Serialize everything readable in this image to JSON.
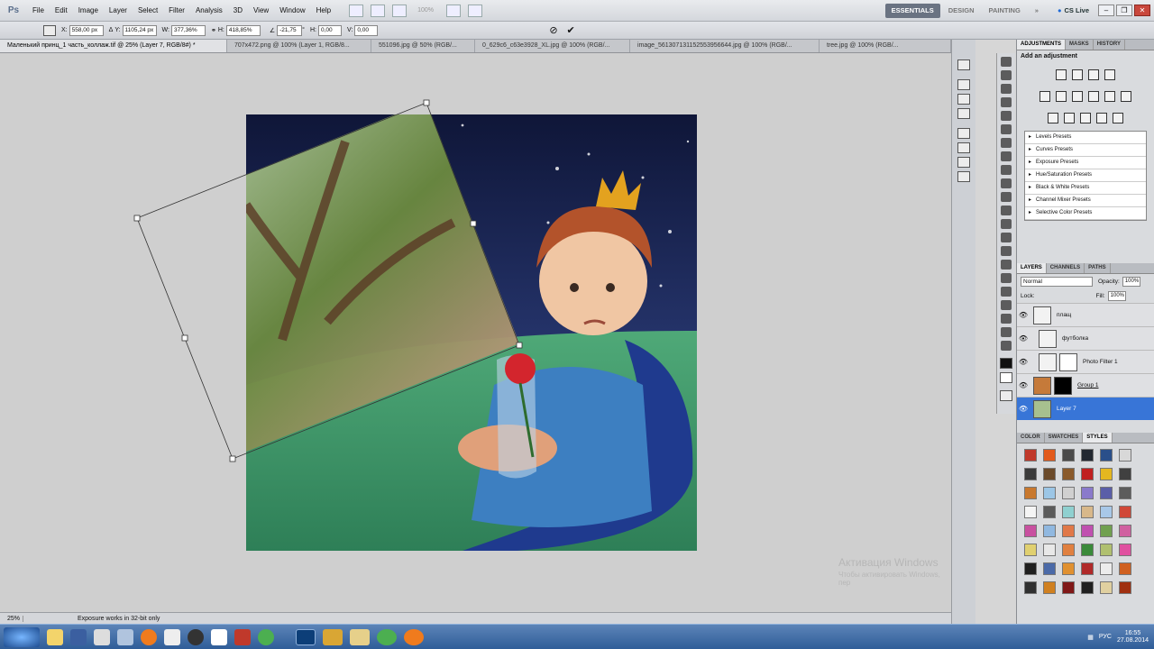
{
  "app": {
    "logo": "Ps",
    "menu": [
      "File",
      "Edit",
      "Image",
      "Layer",
      "Select",
      "Filter",
      "Analysis",
      "3D",
      "View",
      "Window",
      "Help"
    ],
    "zoom_dropdown": "100%",
    "workspaces": [
      "ESSENTIALS",
      "DESIGN",
      "PAINTING"
    ],
    "active_workspace": "ESSENTIALS",
    "more": "»",
    "cs_live": "CS Live"
  },
  "options": {
    "x_label": "X:",
    "x_value": "558,00 px",
    "y_label": "Y:",
    "y_value": "1105,24 px",
    "w_label": "W:",
    "w_value": "377,36%",
    "h_label": "H:",
    "h_value": "418,85%",
    "angle_value": "-21,75",
    "angle_unit": "°",
    "hskew_label": "H:",
    "hskew_value": "0,00",
    "vskew_label": "V:",
    "vskew_value": "0,00"
  },
  "tabs": [
    "Маленький принц_1 часть_коллаж.tif @ 25% (Layer 7, RGB/8#) *",
    "707x472.png @ 100% (Layer 1, RGB/8...",
    "551096.jpg @ 50% (RGB/...",
    "0_629c6_c63e3928_XL.jpg @ 100% (RGB/...",
    "image_561307131152553956644.jpg @ 100% (RGB/...",
    "tree.jpg @ 100% (RGB/..."
  ],
  "status": {
    "zoom": "25%",
    "message": "Exposure works in 32-bit only"
  },
  "watermark": {
    "title": "Активация Windows",
    "subtitle": "Чтобы активировать Windows, пер"
  },
  "adjustments": {
    "tabs": [
      "ADJUSTMENTS",
      "MASKS",
      "HISTORY"
    ],
    "title": "Add an adjustment",
    "presets": [
      "Levels Presets",
      "Curves Presets",
      "Exposure Presets",
      "Hue/Saturation Presets",
      "Black & White Presets",
      "Channel Mixer Presets",
      "Selective Color Presets"
    ]
  },
  "layers": {
    "tabs": [
      "LAYERS",
      "CHANNELS",
      "PATHS"
    ],
    "blend_mode": "Normal",
    "opacity_label": "Opacity:",
    "opacity_value": "100%",
    "lock_label": "Lock:",
    "fill_label": "Fill:",
    "fill_value": "100%",
    "items": [
      {
        "name": "плащ",
        "selected": false
      },
      {
        "name": "футболка",
        "selected": false
      },
      {
        "name": "Photo Filter 1",
        "selected": false
      },
      {
        "name": "Group 1",
        "selected": false
      },
      {
        "name": "Layer 7",
        "selected": true
      }
    ]
  },
  "styles": {
    "tabs": [
      "COLOR",
      "SWATCHES",
      "STYLES"
    ],
    "colors": [
      "#c0392b",
      "#e25a1c",
      "#4a4a4a",
      "#222831",
      "#2a4f8a",
      "#d8d8d8",
      "#3b3b3b",
      "#6b4a2a",
      "#8a5a2b",
      "#c02020",
      "#e4b720",
      "#404040",
      "#c8782e",
      "#9cc6e6",
      "#d0d0d0",
      "#8a7acb",
      "#5a5ea8",
      "#5c5c5c",
      "#f4f4f4",
      "#5b5b5b",
      "#8fd0d0",
      "#d8b88a",
      "#a8c8e8",
      "#d04838",
      "#c850a0",
      "#90b8e0",
      "#e07848",
      "#c050b0",
      "#70a050",
      "#d060a0",
      "#e0d070",
      "#e8e8e8",
      "#e08040",
      "#3a8a3a",
      "#b0c070",
      "#e050a0",
      "#202020",
      "#4b6aa8",
      "#e09030",
      "#b02a2a",
      "#ececec",
      "#d06020",
      "#303030",
      "#d08020",
      "#801818",
      "#202020",
      "#e0d0a0",
      "#a03010",
      "#202020",
      "#d09020",
      "#3a3a3a",
      "#202020",
      "#c8c8c8",
      "#303030"
    ]
  },
  "taskbar": {
    "lang": "РУС",
    "time": "16:55",
    "date": "27.08.2014"
  }
}
